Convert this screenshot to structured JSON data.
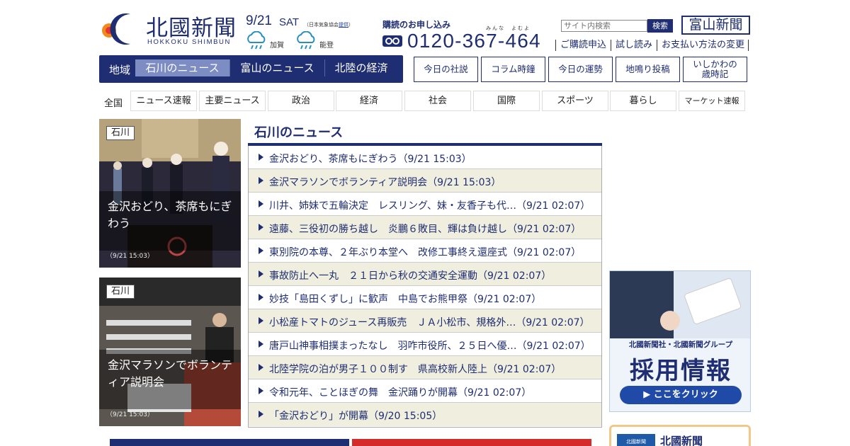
{
  "header": {
    "logo_text": "北國新聞",
    "logo_sub": "HOKKOKU SHIMBUN",
    "date": "9/21",
    "day_of_week": "SAT",
    "weather_source_prefix": "（日本気象協会",
    "weather_source_link": "提供",
    "weather_source_suffix": "）",
    "weather": [
      {
        "region": "加賀",
        "icon": "rain-cloud-icon"
      },
      {
        "region": "能登",
        "icon": "rain-cloud-icon"
      }
    ],
    "subscribe_title": "購読のお申し込み",
    "phone_ruby_1": "みんな",
    "phone_ruby_2": "よむよ",
    "phone_number": "0120-367-464",
    "search_placeholder": "サイト内検索",
    "search_button": "検索",
    "toyama_logo": "富山新聞",
    "sub_links": [
      "ご購読申込",
      "試し読み",
      "お支払い方法の変更"
    ]
  },
  "region_nav": {
    "label": "地域",
    "tabs": [
      "石川のニュース",
      "富山のニュース",
      "北陸の経済"
    ],
    "active_tab": "石川のニュース"
  },
  "top_buttons": [
    "今日の社説",
    "コラム時鐘",
    "今日の運勢",
    "地鳴り投稿",
    "いしかわの\n歳時記"
  ],
  "category_nav": {
    "label": "全国",
    "items": [
      "ニュース速報",
      "主要ニュース",
      "政治",
      "経済",
      "社会",
      "国際",
      "スポーツ",
      "暮らし",
      "マーケット速報"
    ]
  },
  "photo_cards": [
    {
      "tag": "石川",
      "caption": "金沢おどり、茶席もにぎわう",
      "time": "（9/21 15:03）"
    },
    {
      "tag": "石川",
      "caption": "金沢マラソンでボランティア説明会",
      "time": "（9/21 15:03）"
    }
  ],
  "news_section": {
    "title": "石川のニュース",
    "items": [
      "金沢おどり、茶席もにぎわう（9/21 15:03）",
      "金沢マラソンでボランティア説明会（9/21 15:03）",
      "川井、姉妹で五輪決定　レスリング、妹・友香子も代…（9/21 02:07）",
      "遠藤、三役初の勝ち越し　炎鵬６敗目、輝は負け越し（9/21 02:07）",
      "東別院の本尊、２年ぶり本堂へ　改修工事終え還座式（9/21 02:07）",
      "事故防止へ一丸　２１日から秋の交通安全運動（9/21 02:07）",
      "妙技「島田くずし」に歓声　中島でお熊甲祭（9/21 02:07）",
      "小松産トマトのジュース再販売　ＪＡ小松市、規格外…（9/21 02:07）",
      "唐戸山神事相撲まったなし　羽咋市役所、２５日へ優…（9/21 02:07）",
      "北陸学院の泊が男子１００制す　県高校新人陸上（9/21 02:07）",
      "令和元年、ことほぎの舞　金沢踊りが開幕（9/21 02:07）",
      "「金沢おどり」が開幕（9/20 15:05）"
    ]
  },
  "recruit_banner": {
    "small": "北國新聞社・北國新聞グループ",
    "big": "採用情報",
    "button": "▶ ここをクリック"
  },
  "app_box": {
    "icon_text": "北國新聞",
    "name": "北國新聞"
  },
  "colors": {
    "brand_navy": "#1f2d72",
    "active_tab": "#7d8dc4",
    "alt_row": "#efeedf"
  }
}
